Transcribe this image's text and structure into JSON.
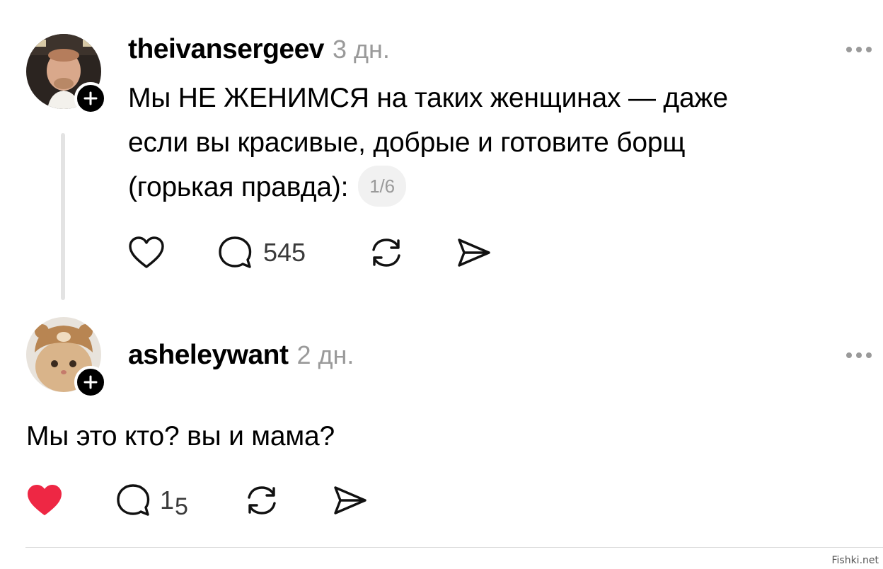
{
  "posts": [
    {
      "username": "theivansergeev",
      "time": "3 дн.",
      "text_lines": [
        "Мы НЕ ЖЕНИМСЯ на таких женщинах — даже",
        "если вы красивые, добрые и готовите борщ",
        "(горькая правда):"
      ],
      "media_counter": "1/6",
      "replies_count": "545",
      "liked": false
    },
    {
      "username": "asheleywant",
      "time": "2 дн.",
      "text": "Мы это кто? вы и мама?",
      "replies_count_main": "1",
      "replies_count_sub": "5",
      "liked": true
    }
  ],
  "icons": {
    "like": "heart-icon",
    "reply": "speech-bubble-icon",
    "repost": "repost-icon",
    "share": "send-icon",
    "more": "more-dots-icon",
    "follow": "plus-icon"
  },
  "colors": {
    "like_active": "#ee2744",
    "meta_gray": "#9a9a9a"
  },
  "watermark": "Fishki.net"
}
